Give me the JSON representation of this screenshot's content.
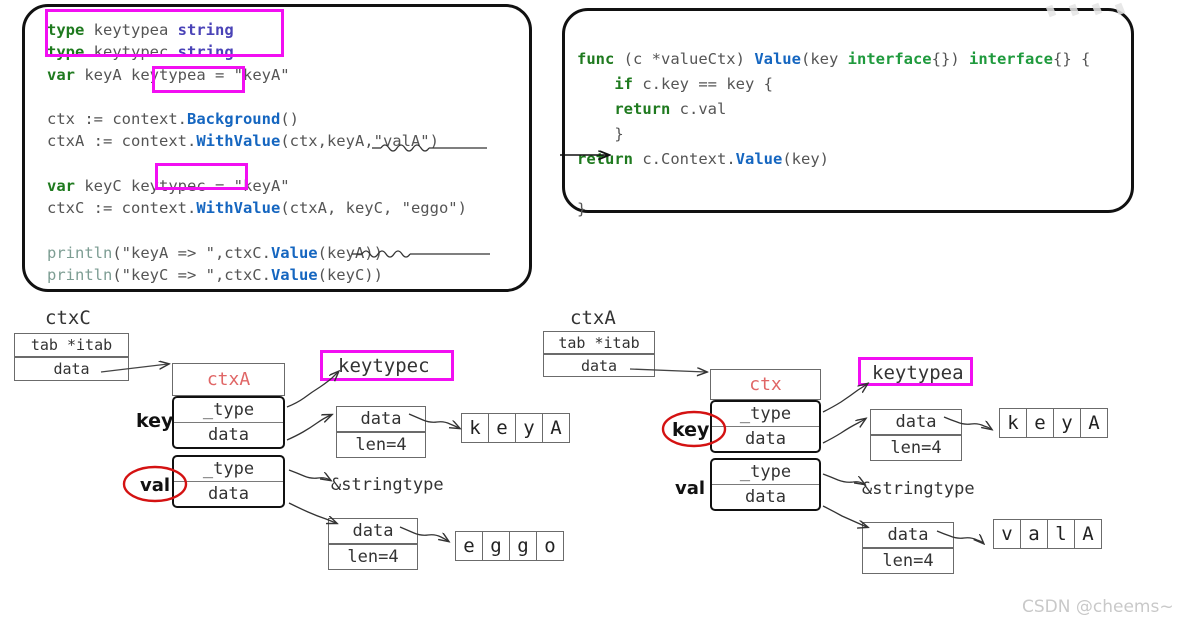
{
  "code_left": {
    "lines": [
      [
        {
          "t": "type",
          "c": "kw"
        },
        {
          "t": " keytypea ",
          "c": "pln"
        },
        {
          "t": "string",
          "c": "typ"
        }
      ],
      [
        {
          "t": "type",
          "c": "kw"
        },
        {
          "t": " keytypec ",
          "c": "pln"
        },
        {
          "t": "string",
          "c": "typ"
        }
      ],
      [
        {
          "t": "var",
          "c": "kw"
        },
        {
          "t": " keyA ",
          "c": "pln"
        },
        {
          "t": "keytypea",
          "c": "pln"
        },
        {
          "t": " = \"keyA\"",
          "c": "pln"
        }
      ],
      [],
      [
        {
          "t": "ctx := context.",
          "c": "pln"
        },
        {
          "t": "Background",
          "c": "fn"
        },
        {
          "t": "()",
          "c": "pln"
        }
      ],
      [
        {
          "t": "ctxA := context.",
          "c": "pln"
        },
        {
          "t": "WithValue",
          "c": "fn"
        },
        {
          "t": "(ctx,keyA,\"valA\")",
          "c": "pln"
        }
      ],
      [],
      [
        {
          "t": "var",
          "c": "kw"
        },
        {
          "t": " keyC ",
          "c": "pln"
        },
        {
          "t": "keytypec",
          "c": "pln"
        },
        {
          "t": " = \"keyA\"",
          "c": "pln"
        }
      ],
      [
        {
          "t": "ctxC := context.",
          "c": "pln"
        },
        {
          "t": "WithValue",
          "c": "fn"
        },
        {
          "t": "(ctxA, keyC, \"eggo\")",
          "c": "pln"
        }
      ],
      [],
      [
        {
          "t": "println",
          "c": "pl"
        },
        {
          "t": "(\"keyA => \",ctxC.",
          "c": "pln"
        },
        {
          "t": "Value",
          "c": "fn"
        },
        {
          "t": "(keyA))",
          "c": "pln"
        }
      ],
      [
        {
          "t": "println",
          "c": "pl"
        },
        {
          "t": "(\"keyC => \",ctxC.",
          "c": "pln"
        },
        {
          "t": "Value",
          "c": "fn"
        },
        {
          "t": "(keyC))",
          "c": "pln"
        }
      ]
    ]
  },
  "code_right": {
    "lines": [
      [
        {
          "t": "func",
          "c": "kw"
        },
        {
          "t": " (c *valueCtx) ",
          "c": "pln"
        },
        {
          "t": "Value",
          "c": "fn"
        },
        {
          "t": "(key ",
          "c": "pln"
        },
        {
          "t": "interface",
          "c": "grn"
        },
        {
          "t": "{}) ",
          "c": "pln"
        },
        {
          "t": "interface",
          "c": "grn"
        },
        {
          "t": "{} {",
          "c": "pln"
        }
      ],
      [
        {
          "t": "    ",
          "c": "pln"
        },
        {
          "t": "if",
          "c": "kw"
        },
        {
          "t": " c.key == key {",
          "c": "pln"
        }
      ],
      [
        {
          "t": "    ",
          "c": "pln"
        },
        {
          "t": "return",
          "c": "kw"
        },
        {
          "t": " c.val",
          "c": "pln"
        }
      ],
      [
        {
          "t": "    }",
          "c": "pln"
        }
      ],
      [
        {
          "t": "",
          "c": "pln"
        },
        {
          "t": "return",
          "c": "kw"
        },
        {
          "t": " c.Context.",
          "c": "pln"
        },
        {
          "t": "Value",
          "c": "fn"
        },
        {
          "t": "(key)",
          "c": "pln"
        }
      ],
      [],
      [
        {
          "t": "}",
          "c": "pln"
        }
      ]
    ]
  },
  "highlights": {
    "types_block": "type keytypea string / type keytypec string",
    "keytypea_inline": "keytypea",
    "keytypec_inline": "keytypec",
    "keytypec_node": "keytypec",
    "keytypea_node": "keytypea"
  },
  "diagram_left": {
    "title": "ctxC",
    "iface_root": {
      "top": "tab *itab",
      "bottom": "data"
    },
    "ctx_header": "ctxA",
    "key_label": "key",
    "val_label": "val",
    "key_iface": {
      "top": "_type",
      "bottom": "data"
    },
    "val_iface": {
      "top": "_type",
      "bottom": "data"
    },
    "type_target": "keytypec",
    "key_string_hdr": {
      "top": "data",
      "bottom": "len=4"
    },
    "key_string_chars": [
      "k",
      "e",
      "y",
      "A"
    ],
    "val_type_target": "&stringtype",
    "val_string_hdr": {
      "top": "data",
      "bottom": "len=4"
    },
    "val_string_chars": [
      "e",
      "g",
      "g",
      "o"
    ]
  },
  "diagram_right": {
    "title": "ctxA",
    "iface_root": {
      "top": "tab *itab",
      "bottom": "data"
    },
    "ctx_header": "ctx",
    "key_label": "key",
    "val_label": "val",
    "key_iface": {
      "top": "_type",
      "bottom": "data"
    },
    "val_iface": {
      "top": "_type",
      "bottom": "data"
    },
    "type_target": "keytypea",
    "key_string_hdr": {
      "top": "data",
      "bottom": "len=4"
    },
    "key_string_chars": [
      "k",
      "e",
      "y",
      "A"
    ],
    "val_type_target": "&stringtype",
    "val_string_hdr": {
      "top": "data",
      "bottom": "len=4"
    },
    "val_string_chars": [
      "v",
      "a",
      "l",
      "A"
    ]
  },
  "watermark": "CSDN @cheems~",
  "colors": {
    "keyword": "#1f7a1f",
    "type": "#4a43b7",
    "func": "#1566c0",
    "println": "#7d9d93",
    "interface": "#1f9a3d",
    "highlight": "#f20ff2",
    "ctx_header": "#e06666",
    "annotation": "#d41212"
  }
}
